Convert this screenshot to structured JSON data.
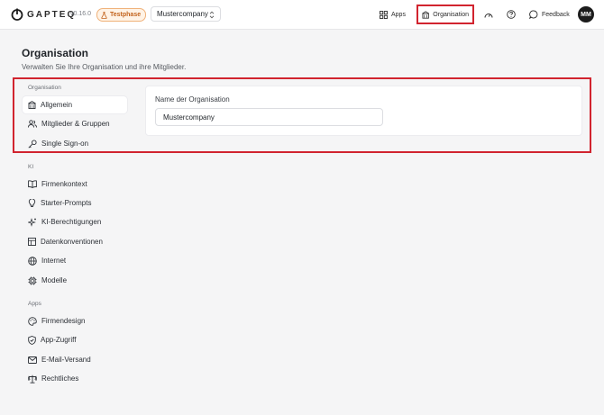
{
  "header": {
    "brand": "GAPTEQ",
    "version": "v0.16.0",
    "badge": "Testphase",
    "company": "Mustercompany",
    "apps_label": "Apps",
    "organisation_label": "Organisation",
    "feedback_label": "Feedback",
    "avatar_initials": "MM"
  },
  "page": {
    "title": "Organisation",
    "subtitle": "Verwalten Sie Ihre Organisation und ihre Mitglieder."
  },
  "sidebar": {
    "sections": [
      {
        "label": "Organisation",
        "items": [
          {
            "label": "Allgemein",
            "icon": "building-icon",
            "selected": true
          },
          {
            "label": "Mitglieder & Gruppen",
            "icon": "users-icon"
          },
          {
            "label": "Single Sign-on",
            "icon": "key-icon"
          }
        ]
      },
      {
        "label": "KI",
        "items": [
          {
            "label": "Firmenkontext",
            "icon": "book-icon"
          },
          {
            "label": "Starter-Prompts",
            "icon": "lightbulb-icon"
          },
          {
            "label": "KI-Berechtigungen",
            "icon": "sparkles-icon"
          },
          {
            "label": "Datenkonventionen",
            "icon": "table-icon"
          },
          {
            "label": "Internet",
            "icon": "globe-icon"
          },
          {
            "label": "Modelle",
            "icon": "chip-icon"
          }
        ]
      },
      {
        "label": "Apps",
        "items": [
          {
            "label": "Firmendesign",
            "icon": "palette-icon"
          },
          {
            "label": "App-Zugriff",
            "icon": "shield-icon"
          },
          {
            "label": "E-Mail-Versand",
            "icon": "mail-icon"
          },
          {
            "label": "Rechtliches",
            "icon": "scale-icon"
          }
        ]
      }
    ]
  },
  "form": {
    "org_name_label": "Name der Organisation",
    "org_name_value": "Mustercompany"
  },
  "colors": {
    "highlight": "#d1242f",
    "badge_text": "#c2621b",
    "background": "#f5f5f6"
  }
}
